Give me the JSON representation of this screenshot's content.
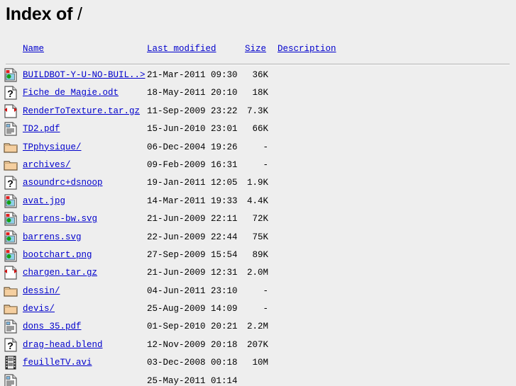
{
  "page": {
    "title_main": "Index of",
    "title_path": "/",
    "background_color": "#eeeeee",
    "link_color": "#0000cc",
    "text_color": "#000000",
    "rule_color": "#b0b0b0"
  },
  "columns": {
    "name": "Name",
    "last_modified": "Last modified",
    "size": "Size",
    "description": "Description"
  },
  "entries": [
    {
      "icon": "image-file-icon",
      "name": "BUILDBOT-Y-U-NO-BUIL..>",
      "date": "21-Mar-2011 09:30",
      "size": "36K",
      "description": ""
    },
    {
      "icon": "unknown-file-icon",
      "name": "Fiche de Magie.odt",
      "date": "18-May-2011 20:10",
      "size": "18K",
      "description": ""
    },
    {
      "icon": "compressed-file-icon",
      "name": "RenderToTexture.tar.gz",
      "date": "11-Sep-2009 23:22",
      "size": "7.3K",
      "description": ""
    },
    {
      "icon": "document-file-icon",
      "name": "TD2.pdf",
      "date": "15-Jun-2010 23:01",
      "size": "66K",
      "description": ""
    },
    {
      "icon": "folder-icon",
      "name": "TPphysique/",
      "date": "06-Dec-2004 19:26",
      "size": "-",
      "description": ""
    },
    {
      "icon": "folder-icon",
      "name": "archives/",
      "date": "09-Feb-2009 16:31",
      "size": "-",
      "description": ""
    },
    {
      "icon": "unknown-file-icon",
      "name": "asoundrc+dsnoop",
      "date": "19-Jan-2011 12:05",
      "size": "1.9K",
      "description": ""
    },
    {
      "icon": "image-file-icon",
      "name": "avat.jpg",
      "date": "14-Mar-2011 19:33",
      "size": "4.4K",
      "description": ""
    },
    {
      "icon": "image-file-icon",
      "name": "barrens-bw.svg",
      "date": "21-Jun-2009 22:11",
      "size": "72K",
      "description": ""
    },
    {
      "icon": "image-file-icon",
      "name": "barrens.svg",
      "date": "22-Jun-2009 22:44",
      "size": "75K",
      "description": ""
    },
    {
      "icon": "image-file-icon",
      "name": "bootchart.png",
      "date": "27-Sep-2009 15:54",
      "size": "89K",
      "description": ""
    },
    {
      "icon": "compressed-file-icon",
      "name": "chargen.tar.gz",
      "date": "21-Jun-2009 12:31",
      "size": "2.0M",
      "description": ""
    },
    {
      "icon": "folder-icon",
      "name": "dessin/",
      "date": "04-Jun-2011 23:10",
      "size": "-",
      "description": ""
    },
    {
      "icon": "folder-icon",
      "name": "devis/",
      "date": "25-Aug-2009 14:09",
      "size": "-",
      "description": ""
    },
    {
      "icon": "document-file-icon",
      "name": "dons 35.pdf",
      "date": "01-Sep-2010 20:21",
      "size": "2.2M",
      "description": ""
    },
    {
      "icon": "unknown-file-icon",
      "name": "drag-head.blend",
      "date": "12-Nov-2009 20:18",
      "size": "207K",
      "description": ""
    },
    {
      "icon": "video-file-icon",
      "name": "feuilleTV.avi",
      "date": "03-Dec-2008 00:18",
      "size": "10M",
      "description": ""
    },
    {
      "icon": "document-file-icon",
      "name": "",
      "date": "25-May-2011 01:14",
      "size": "",
      "description": ""
    }
  ]
}
